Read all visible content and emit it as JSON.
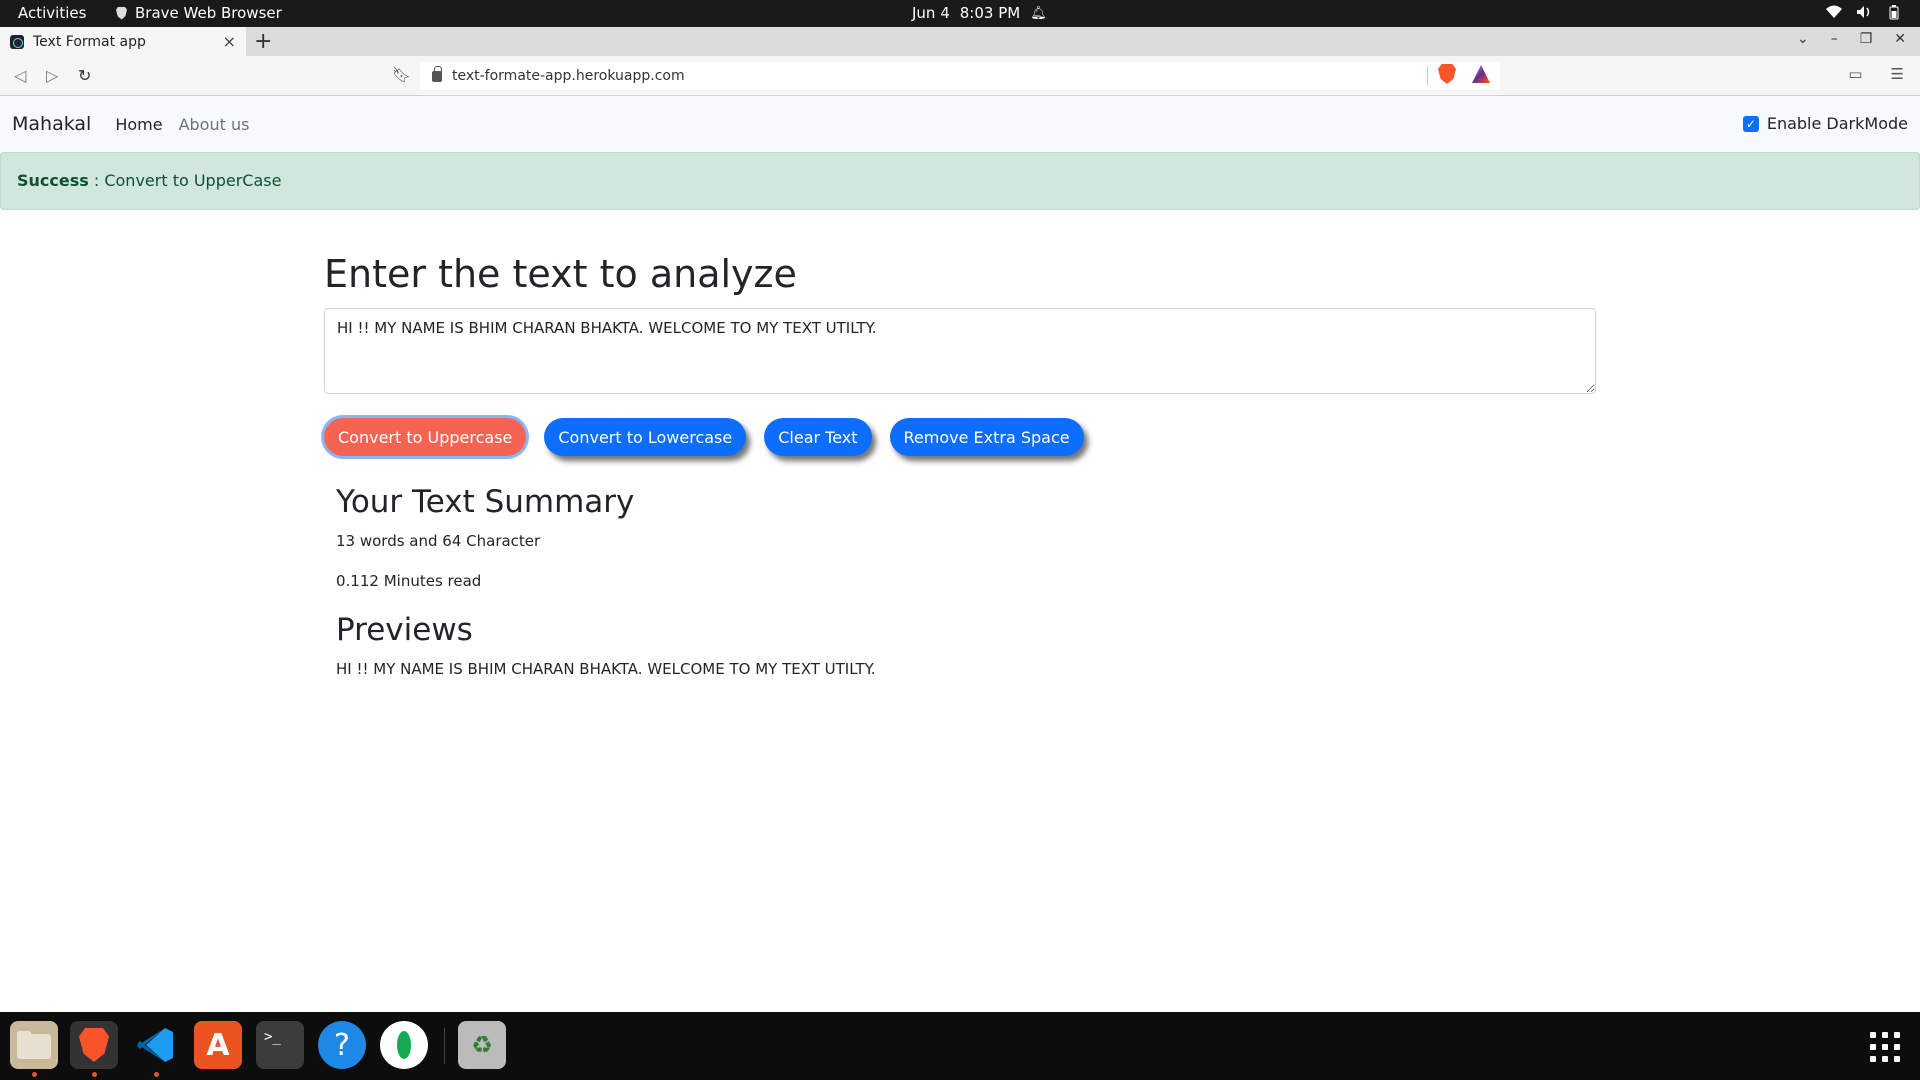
{
  "system": {
    "activities": "Activities",
    "app_name": "Brave Web Browser",
    "date": "Jun 4",
    "time": "8:03 PM"
  },
  "browser": {
    "tab_title": "Text Format app",
    "tab_close": "×",
    "new_tab": "+",
    "url": "text-formate-app.herokuapp.com",
    "window_controls": [
      "⌄",
      "–",
      "❐",
      "✕"
    ]
  },
  "app": {
    "brand": "Mahakal",
    "nav": [
      {
        "label": "Home",
        "active": true
      },
      {
        "label": "About us",
        "active": false
      }
    ],
    "dark_mode_label": "Enable DarkMode",
    "dark_mode_checked": true,
    "alert": {
      "type": "Success",
      "separator": " : ",
      "message": "Convert to UpperCase"
    },
    "heading": "Enter the text to analyze",
    "text_value": "HI !! MY NAME IS BHIM CHARAN BHAKTA. WELCOME TO MY TEXT UTILTY.",
    "buttons": [
      {
        "label": "Convert to Uppercase"
      },
      {
        "label": "Convert to Lowercase"
      },
      {
        "label": "Clear Text"
      },
      {
        "label": "Remove Extra Space"
      }
    ],
    "summary_heading": "Your Text Summary",
    "summary_counts": "13 words and 64 Character",
    "read_time": "0.112 Minutes read",
    "preview_heading": "Previews",
    "preview_text": "HI !! MY NAME IS BHIM CHARAN BHAKTA. WELCOME TO MY TEXT UTILTY."
  },
  "dock": {
    "items": [
      "files-icon",
      "brave-icon",
      "vscode-icon",
      "app-center-icon",
      "terminal-icon",
      "help-icon",
      "mongodb-compass-icon",
      "trash-icon"
    ]
  },
  "colors": {
    "primary": "#0d6efd",
    "uppercase_button": "#f56453",
    "alert_bg": "#d1e7dd",
    "alert_text": "#0f5132"
  }
}
